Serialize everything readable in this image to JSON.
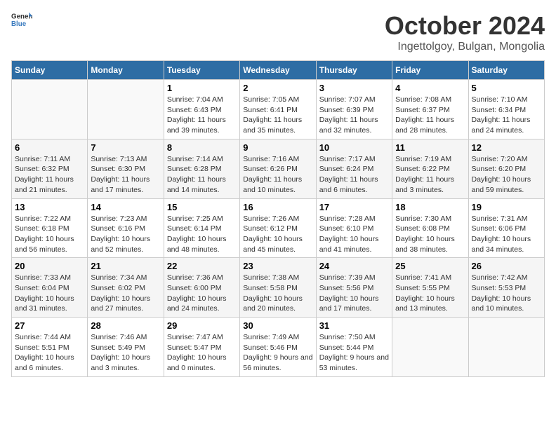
{
  "header": {
    "logo_general": "General",
    "logo_blue": "Blue",
    "month_title": "October 2024",
    "location": "Ingettolgoy, Bulgan, Mongolia"
  },
  "days_of_week": [
    "Sunday",
    "Monday",
    "Tuesday",
    "Wednesday",
    "Thursday",
    "Friday",
    "Saturday"
  ],
  "weeks": [
    [
      {
        "day": null
      },
      {
        "day": null
      },
      {
        "day": 1,
        "sunrise": "7:04 AM",
        "sunset": "6:43 PM",
        "daylight": "11 hours and 39 minutes."
      },
      {
        "day": 2,
        "sunrise": "7:05 AM",
        "sunset": "6:41 PM",
        "daylight": "11 hours and 35 minutes."
      },
      {
        "day": 3,
        "sunrise": "7:07 AM",
        "sunset": "6:39 PM",
        "daylight": "11 hours and 32 minutes."
      },
      {
        "day": 4,
        "sunrise": "7:08 AM",
        "sunset": "6:37 PM",
        "daylight": "11 hours and 28 minutes."
      },
      {
        "day": 5,
        "sunrise": "7:10 AM",
        "sunset": "6:34 PM",
        "daylight": "11 hours and 24 minutes."
      }
    ],
    [
      {
        "day": 6,
        "sunrise": "7:11 AM",
        "sunset": "6:32 PM",
        "daylight": "11 hours and 21 minutes."
      },
      {
        "day": 7,
        "sunrise": "7:13 AM",
        "sunset": "6:30 PM",
        "daylight": "11 hours and 17 minutes."
      },
      {
        "day": 8,
        "sunrise": "7:14 AM",
        "sunset": "6:28 PM",
        "daylight": "11 hours and 14 minutes."
      },
      {
        "day": 9,
        "sunrise": "7:16 AM",
        "sunset": "6:26 PM",
        "daylight": "11 hours and 10 minutes."
      },
      {
        "day": 10,
        "sunrise": "7:17 AM",
        "sunset": "6:24 PM",
        "daylight": "11 hours and 6 minutes."
      },
      {
        "day": 11,
        "sunrise": "7:19 AM",
        "sunset": "6:22 PM",
        "daylight": "11 hours and 3 minutes."
      },
      {
        "day": 12,
        "sunrise": "7:20 AM",
        "sunset": "6:20 PM",
        "daylight": "10 hours and 59 minutes."
      }
    ],
    [
      {
        "day": 13,
        "sunrise": "7:22 AM",
        "sunset": "6:18 PM",
        "daylight": "10 hours and 56 minutes."
      },
      {
        "day": 14,
        "sunrise": "7:23 AM",
        "sunset": "6:16 PM",
        "daylight": "10 hours and 52 minutes."
      },
      {
        "day": 15,
        "sunrise": "7:25 AM",
        "sunset": "6:14 PM",
        "daylight": "10 hours and 48 minutes."
      },
      {
        "day": 16,
        "sunrise": "7:26 AM",
        "sunset": "6:12 PM",
        "daylight": "10 hours and 45 minutes."
      },
      {
        "day": 17,
        "sunrise": "7:28 AM",
        "sunset": "6:10 PM",
        "daylight": "10 hours and 41 minutes."
      },
      {
        "day": 18,
        "sunrise": "7:30 AM",
        "sunset": "6:08 PM",
        "daylight": "10 hours and 38 minutes."
      },
      {
        "day": 19,
        "sunrise": "7:31 AM",
        "sunset": "6:06 PM",
        "daylight": "10 hours and 34 minutes."
      }
    ],
    [
      {
        "day": 20,
        "sunrise": "7:33 AM",
        "sunset": "6:04 PM",
        "daylight": "10 hours and 31 minutes."
      },
      {
        "day": 21,
        "sunrise": "7:34 AM",
        "sunset": "6:02 PM",
        "daylight": "10 hours and 27 minutes."
      },
      {
        "day": 22,
        "sunrise": "7:36 AM",
        "sunset": "6:00 PM",
        "daylight": "10 hours and 24 minutes."
      },
      {
        "day": 23,
        "sunrise": "7:38 AM",
        "sunset": "5:58 PM",
        "daylight": "10 hours and 20 minutes."
      },
      {
        "day": 24,
        "sunrise": "7:39 AM",
        "sunset": "5:56 PM",
        "daylight": "10 hours and 17 minutes."
      },
      {
        "day": 25,
        "sunrise": "7:41 AM",
        "sunset": "5:55 PM",
        "daylight": "10 hours and 13 minutes."
      },
      {
        "day": 26,
        "sunrise": "7:42 AM",
        "sunset": "5:53 PM",
        "daylight": "10 hours and 10 minutes."
      }
    ],
    [
      {
        "day": 27,
        "sunrise": "7:44 AM",
        "sunset": "5:51 PM",
        "daylight": "10 hours and 6 minutes."
      },
      {
        "day": 28,
        "sunrise": "7:46 AM",
        "sunset": "5:49 PM",
        "daylight": "10 hours and 3 minutes."
      },
      {
        "day": 29,
        "sunrise": "7:47 AM",
        "sunset": "5:47 PM",
        "daylight": "10 hours and 0 minutes."
      },
      {
        "day": 30,
        "sunrise": "7:49 AM",
        "sunset": "5:46 PM",
        "daylight": "9 hours and 56 minutes."
      },
      {
        "day": 31,
        "sunrise": "7:50 AM",
        "sunset": "5:44 PM",
        "daylight": "9 hours and 53 minutes."
      },
      {
        "day": null
      },
      {
        "day": null
      }
    ]
  ]
}
